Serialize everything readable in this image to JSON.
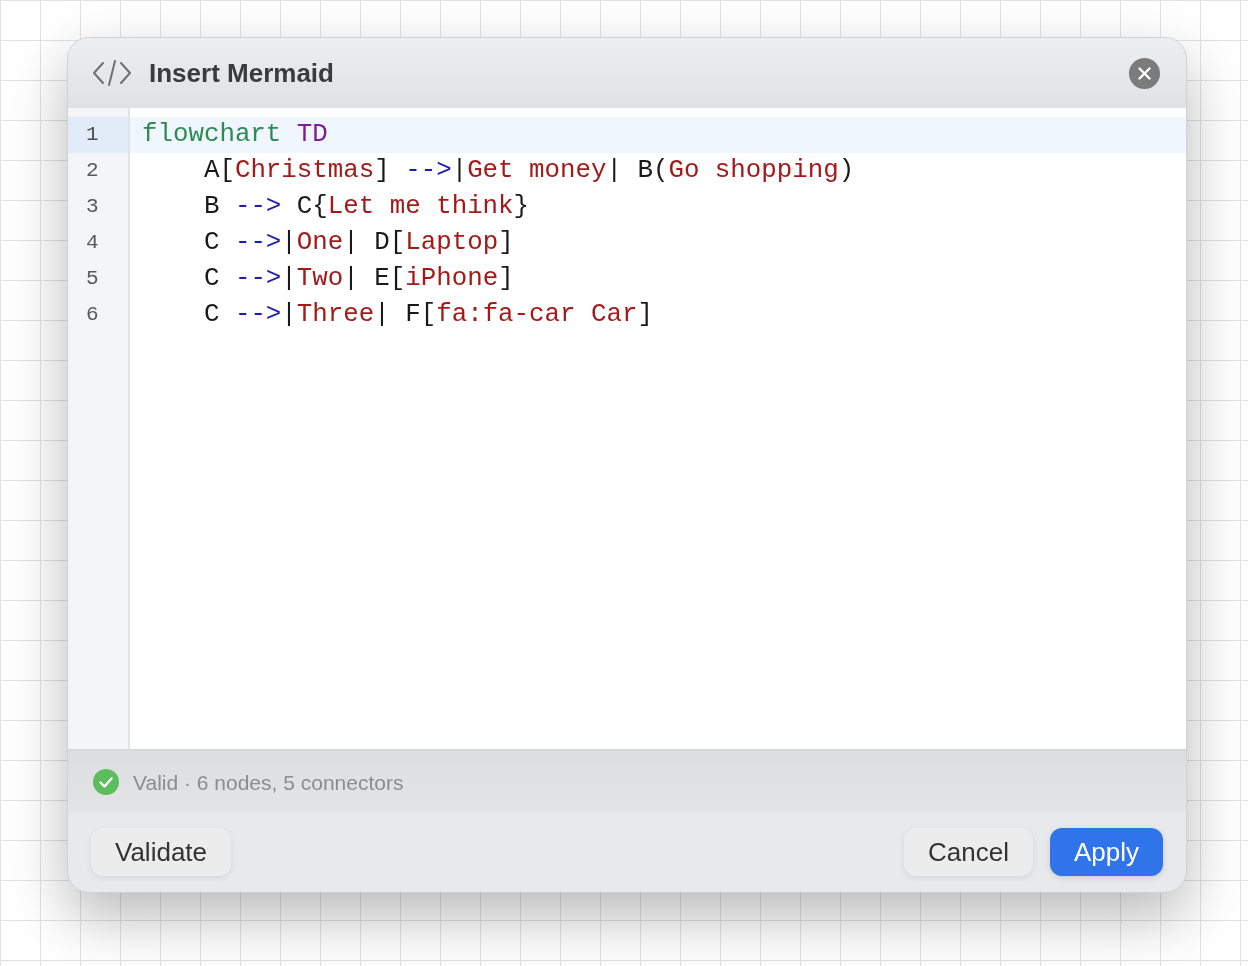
{
  "dialog": {
    "title": "Insert Mermaid"
  },
  "editor": {
    "lines": [
      {
        "number": "1",
        "current": true,
        "tokens": [
          {
            "kind": "keyword",
            "text": "flowchart "
          },
          {
            "kind": "direction",
            "text": "TD"
          }
        ]
      },
      {
        "number": "2",
        "current": false,
        "tokens": [
          {
            "kind": "plain",
            "text": "    A["
          },
          {
            "kind": "string",
            "text": "Christmas"
          },
          {
            "kind": "plain",
            "text": "] "
          },
          {
            "kind": "arrow",
            "text": "-->"
          },
          {
            "kind": "plain",
            "text": "|"
          },
          {
            "kind": "string",
            "text": "Get money"
          },
          {
            "kind": "plain",
            "text": "| B("
          },
          {
            "kind": "string",
            "text": "Go shopping"
          },
          {
            "kind": "plain",
            "text": ")"
          }
        ]
      },
      {
        "number": "3",
        "current": false,
        "tokens": [
          {
            "kind": "plain",
            "text": "    B "
          },
          {
            "kind": "arrow",
            "text": "-->"
          },
          {
            "kind": "plain",
            "text": " C{"
          },
          {
            "kind": "string",
            "text": "Let me think"
          },
          {
            "kind": "plain",
            "text": "}"
          }
        ]
      },
      {
        "number": "4",
        "current": false,
        "tokens": [
          {
            "kind": "plain",
            "text": "    C "
          },
          {
            "kind": "arrow",
            "text": "-->"
          },
          {
            "kind": "plain",
            "text": "|"
          },
          {
            "kind": "string",
            "text": "One"
          },
          {
            "kind": "plain",
            "text": "| D["
          },
          {
            "kind": "string",
            "text": "Laptop"
          },
          {
            "kind": "plain",
            "text": "]"
          }
        ]
      },
      {
        "number": "5",
        "current": false,
        "tokens": [
          {
            "kind": "plain",
            "text": "    C "
          },
          {
            "kind": "arrow",
            "text": "-->"
          },
          {
            "kind": "plain",
            "text": "|"
          },
          {
            "kind": "string",
            "text": "Two"
          },
          {
            "kind": "plain",
            "text": "| E["
          },
          {
            "kind": "string",
            "text": "iPhone"
          },
          {
            "kind": "plain",
            "text": "]"
          }
        ]
      },
      {
        "number": "6",
        "current": false,
        "tokens": [
          {
            "kind": "plain",
            "text": "    C "
          },
          {
            "kind": "arrow",
            "text": "-->"
          },
          {
            "kind": "plain",
            "text": "|"
          },
          {
            "kind": "string",
            "text": "Three"
          },
          {
            "kind": "plain",
            "text": "| F["
          },
          {
            "kind": "string",
            "text": "fa:fa-car Car"
          },
          {
            "kind": "plain",
            "text": "]"
          }
        ]
      }
    ]
  },
  "status": {
    "valid": true,
    "text": "Valid · 6 nodes, 5 connectors"
  },
  "footer": {
    "left_buttons": [
      {
        "label": "Validate",
        "kind": "secondary"
      }
    ],
    "right_buttons": [
      {
        "label": "Cancel",
        "kind": "secondary"
      },
      {
        "label": "Apply",
        "kind": "primary"
      }
    ]
  }
}
